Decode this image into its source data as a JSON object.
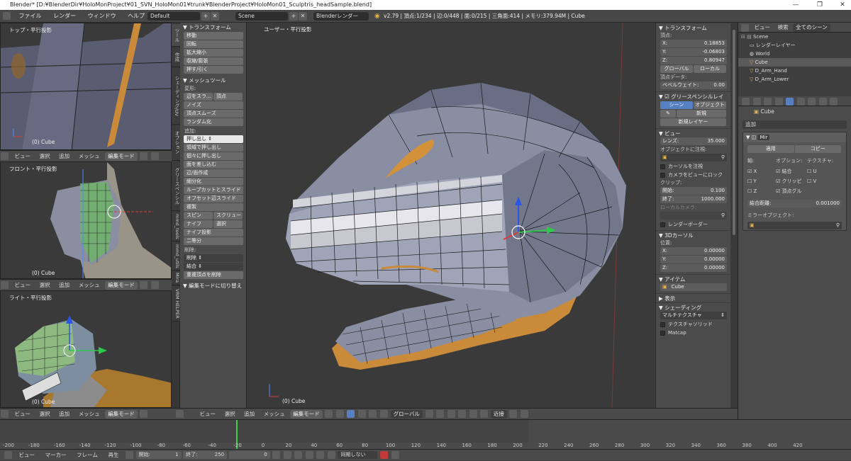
{
  "titlebar": {
    "text": "Blender* [D:¥BlenderDir¥HoloMonProject¥01_SVN_HoloMon01¥trunk¥BlenderProject¥HoloMon01_Sculptris_headSample.blend]",
    "minimize": "—",
    "maximize": "❐",
    "close": "✕"
  },
  "infobar": {
    "menus": [
      "ファイル",
      "レンダー",
      "ウィンドウ",
      "ヘルプ"
    ],
    "layout": "Default",
    "scene": "Scene",
    "engine": "Blenderレンダー",
    "stats": "v2.79 | 頂点:1/234 | 辺:0/448 | 面:0/215 | 三角面:414 | メモリ:379.94M | Cube"
  },
  "viewports": {
    "top": {
      "label": "トップ・平行投影",
      "obj": "(0) Cube"
    },
    "front": {
      "label": "フロント・平行投影",
      "obj": "(0) Cube"
    },
    "right": {
      "label": "ライト・平行投影",
      "obj": "(0) Cube"
    },
    "main": {
      "label": "ユーザー・平行投影",
      "obj": "(0) Cube"
    }
  },
  "viewheader": {
    "menus": [
      "ビュー",
      "選択",
      "追加",
      "メッシュ"
    ],
    "mode": "編集モード",
    "orientation": "グローバル",
    "snap": "近接"
  },
  "tabs": [
    "ツール",
    "作成",
    "シェーディング/UV",
    "オプション",
    "グリースペンシル",
    "mmd_tools",
    "mmd_utils",
    "Mira",
    "VRM HELPER"
  ],
  "toolshelf": {
    "transform_title": "▼ トランスフォーム",
    "transform": [
      "移動",
      "回転",
      "拡大縮小",
      "収縮/膨張",
      "押す/引く"
    ],
    "meshtools_title": "▼ メッシュツール",
    "deform_label": "変形:",
    "deform_row": [
      "辺をスラ...",
      "頂点"
    ],
    "deform": [
      "ノイズ",
      "頂点スムーズ",
      "ランダム化"
    ],
    "add_label": "追加:",
    "extrude": "押し出し ⇕",
    "add": [
      "領域で押し出し",
      "個々に押し出し",
      "面を差し込む",
      "辺/面作成",
      "細分化",
      "ループカットとスライド",
      "オフセット辺スライド",
      "複製"
    ],
    "spin_row": [
      "スピン",
      "スクリュー"
    ],
    "knife_row": [
      "ナイフ",
      "選択"
    ],
    "add2": [
      "ナイフ投影",
      "二等分"
    ],
    "remove_label": "削除:",
    "remove": [
      "削除 ⇕",
      "結合 ⇕"
    ],
    "remove_doubles": "重複頂点を削除",
    "editmode_toggle": "▼ 編集モードに切り替え"
  },
  "npanel": {
    "transform_title": "▼ トランスフォーム",
    "vertex_label": "頂点:",
    "x": [
      "X:",
      "0.18853"
    ],
    "y": [
      "Y:",
      "-0.06803"
    ],
    "z": [
      "Z:",
      "0.80947"
    ],
    "global": "グローバル",
    "local": "ローカル",
    "vertex_data": "頂点データ:",
    "bevel": [
      "ベベルウェイト:",
      "0.00"
    ],
    "grease_title": "▼ ☑ グリースペンシルレイ",
    "scene_btn": "シーン",
    "object_btn": "オブジェクト",
    "new_btn": "新規",
    "new_layer": "新規レイヤー",
    "view_title": "▼ ビュー",
    "lens": [
      "レンズ:",
      "35.000"
    ],
    "lock_label": "オブジェクトに注視:",
    "lock_cursor": "カーソルを注視",
    "lock_camera": "カメラをビューにロック",
    "clip_label": "クリップ:",
    "clip_start": [
      "開始:",
      "0.100"
    ],
    "clip_end": [
      "終了:",
      "1000.000"
    ],
    "local_camera": "ローカルカメラ:",
    "render_border": "レンダーボーダー",
    "cursor_title": "▼ 3Dカーソル",
    "location": "位置:",
    "cx": [
      "X:",
      "0.00000"
    ],
    "cy": [
      "Y:",
      "0.00000"
    ],
    "cz": [
      "Z:",
      "0.00000"
    ],
    "item_title": "▼ アイテム",
    "item_name": "Cube",
    "display_title": "▶ 表示",
    "shading_title": "▼ シェーディング",
    "shading_mode": "マルチテクスチャ",
    "textured_solid": "テクスチャソリッド",
    "matcap": "Matcap"
  },
  "outliner": {
    "view": "ビュー",
    "search": "検索",
    "filter": "全てのシーン",
    "rows": [
      "Scene",
      "レンダーレイヤー",
      "World",
      "Cube",
      "D_Arm_Hand",
      "D_Arm_Lower"
    ]
  },
  "properties": {
    "object": "Cube",
    "add_modifier": "追加",
    "modifier_name": "Mir",
    "apply": "適用",
    "copy": "コピー",
    "axis_label": "軸:",
    "options_label": "オプション:",
    "texture_label": "テクスチャ:",
    "x": "X",
    "y": "Y",
    "z": "Z",
    "merge": "結合",
    "clipping": "クリッピ",
    "vgroups": "頂点グル",
    "u": "U",
    "v": "V",
    "merge_dist": [
      "結合距離:",
      "0.001000"
    ],
    "mirror_obj": "ミラーオブジェクト:"
  },
  "timeline": {
    "ticks": [
      "-200",
      "-180",
      "-160",
      "-140",
      "-120",
      "-100",
      "-80",
      "-60",
      "-40",
      "-20",
      "0",
      "20",
      "40",
      "60",
      "80",
      "100",
      "120",
      "140",
      "160",
      "180",
      "200",
      "220",
      "240",
      "260",
      "280",
      "300",
      "320",
      "340",
      "360",
      "380",
      "400",
      "420"
    ],
    "menus": [
      "ビュー",
      "マーカー",
      "フレーム",
      "再生"
    ],
    "start": [
      "開始:",
      "1"
    ],
    "end": [
      "終了:",
      "250"
    ],
    "current": "0",
    "sync": "同期しない"
  }
}
